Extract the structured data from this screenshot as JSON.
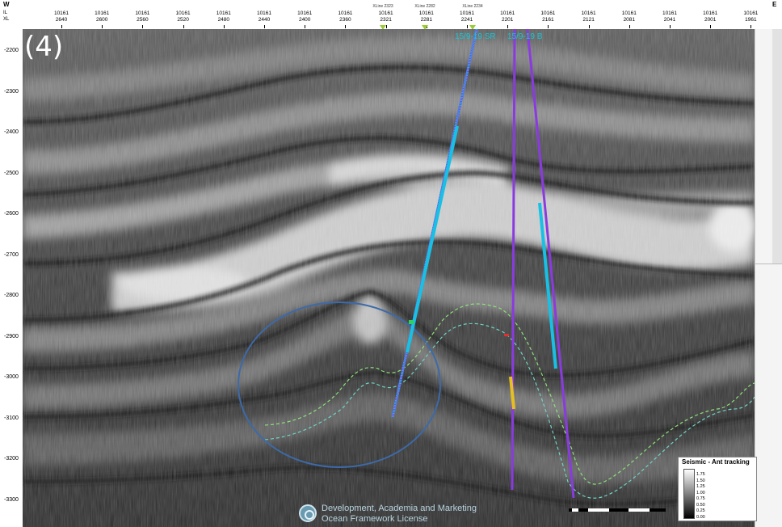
{
  "directions": {
    "west": "W",
    "east": "E"
  },
  "axis_left_labels": [
    "IL",
    "XL"
  ],
  "inline_ticks": [
    {
      "il": "10161",
      "xl": "2640"
    },
    {
      "il": "10161",
      "xl": "2600"
    },
    {
      "il": "10161",
      "xl": "2560"
    },
    {
      "il": "10161",
      "xl": "2520"
    },
    {
      "il": "10161",
      "xl": "2480"
    },
    {
      "il": "10161",
      "xl": "2440"
    },
    {
      "il": "10161",
      "xl": "2400"
    },
    {
      "il": "10161",
      "xl": "2360"
    },
    {
      "il": "10161",
      "xl": "2321"
    },
    {
      "il": "10161",
      "xl": "2281"
    },
    {
      "il": "10161",
      "xl": "2241"
    },
    {
      "il": "10161",
      "xl": "2201"
    },
    {
      "il": "10161",
      "xl": "2161"
    },
    {
      "il": "10161",
      "xl": "2121"
    },
    {
      "il": "10161",
      "xl": "2081"
    },
    {
      "il": "10161",
      "xl": "2041"
    },
    {
      "il": "10161",
      "xl": "2001"
    },
    {
      "il": "10161",
      "xl": "1961"
    }
  ],
  "xline_tags": [
    "XLine 2323",
    "XLine 2282",
    "XLine 2234"
  ],
  "depth_ticks": [
    "-2200",
    "-2300",
    "-2400",
    "-2500",
    "-2600",
    "-2700",
    "-2800",
    "-2900",
    "-3000",
    "-3100",
    "-3200",
    "-3300"
  ],
  "figure_label": "(4)",
  "wells": [
    "15/9-19 SR",
    "15/9-19 B"
  ],
  "legend": {
    "title": "Seismic - Ant tracking",
    "values": [
      "1.75",
      "1.50",
      "1.25",
      "1.00",
      "0.75",
      "0.50",
      "0.25",
      "0.00"
    ]
  },
  "watermark": {
    "line1": "Development, Academia and Marketing",
    "line2": "Ocean Framework License"
  },
  "colors": {
    "well_cyan": "#19c0e6",
    "well_purple": "#8a3be0",
    "horizon_green": "#7ac56a",
    "ellipse": "#3d6aa8"
  }
}
